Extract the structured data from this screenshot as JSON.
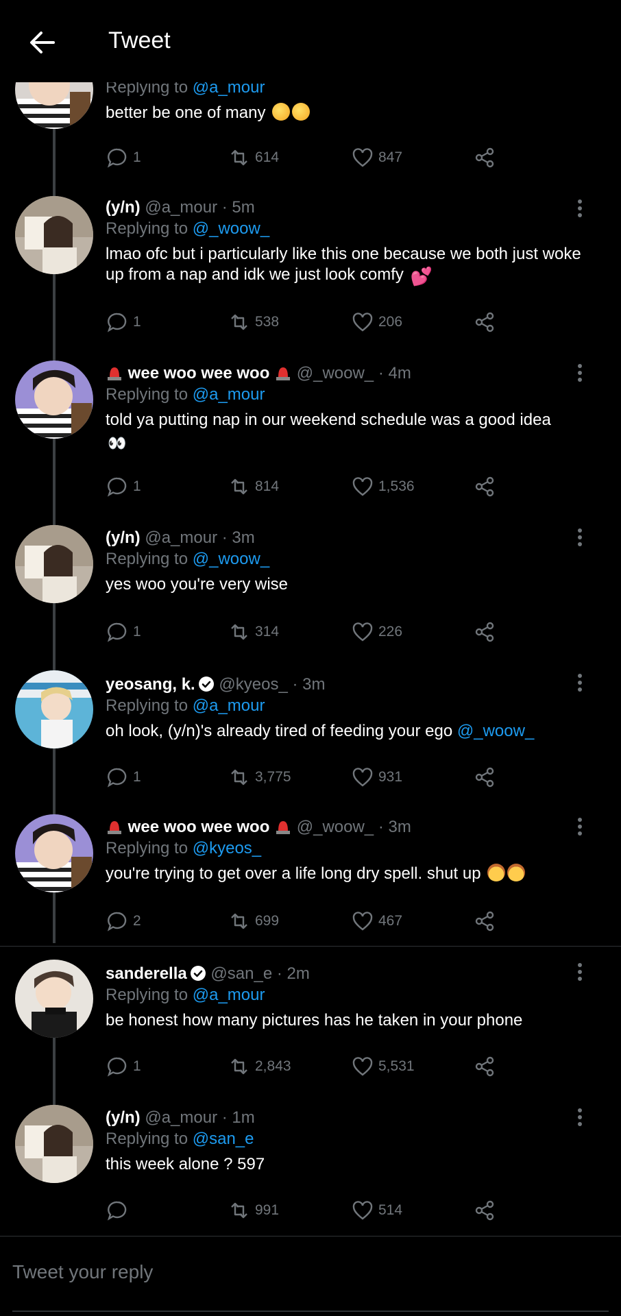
{
  "header": {
    "title": "Tweet"
  },
  "tweets": [
    {
      "name": "",
      "handle": "",
      "time": "",
      "reply_label": "Replying to",
      "reply_to": "@a_mour",
      "text": "better be one of many",
      "replies": "1",
      "retweets": "614",
      "likes": "847",
      "avatar": "boy-striped"
    },
    {
      "name": "(y/n)",
      "handle": "@a_mour",
      "time": "5m",
      "reply_label": "Replying to",
      "reply_to": "@_woow_",
      "text": "lmao ofc but i particularly like this one because we both just woke up from a nap and idk we just look comfy",
      "replies": "1",
      "retweets": "538",
      "likes": "206",
      "avatar": "girl-book"
    },
    {
      "name": "wee woo wee woo",
      "handle": "@_woow_",
      "time": "4m",
      "reply_label": "Replying to",
      "reply_to": "@a_mour",
      "text": "told ya putting nap in our weekend schedule was a good idea",
      "replies": "1",
      "retweets": "814",
      "likes": "1,536",
      "avatar": "boy-striped"
    },
    {
      "name": "(y/n)",
      "handle": "@a_mour",
      "time": "3m",
      "reply_label": "Replying to",
      "reply_to": "@_woow_",
      "text": "yes woo you're very wise",
      "replies": "1",
      "retweets": "314",
      "likes": "226",
      "avatar": "girl-book"
    },
    {
      "name": "yeosang, k.",
      "handle": "@kyeos_",
      "time": "3m",
      "reply_label": "Replying to",
      "reply_to": "@a_mour",
      "text": "oh look, (y/n)'s already tired of feeding your ego",
      "text_mention": "@_woow_",
      "replies": "1",
      "retweets": "3,775",
      "likes": "931",
      "avatar": "boy-pool"
    },
    {
      "name": "wee woo wee woo",
      "handle": "@_woow_",
      "time": "3m",
      "reply_label": "Replying to",
      "reply_to": "@kyeos_",
      "text": "you're trying to get over a life long dry spell. shut up",
      "replies": "2",
      "retweets": "699",
      "likes": "467",
      "avatar": "boy-striped"
    },
    {
      "name": "sanderella",
      "handle": "@san_e",
      "time": "2m",
      "reply_label": "Replying to",
      "reply_to": "@a_mour",
      "text": "be honest how many pictures has he taken in your phone",
      "replies": "1",
      "retweets": "2,843",
      "likes": "5,531",
      "avatar": "boy-black"
    },
    {
      "name": "(y/n)",
      "handle": "@a_mour",
      "time": "1m",
      "reply_label": "Replying to",
      "reply_to": "@san_e",
      "text": "this week alone ? 597",
      "replies": "",
      "retweets": "991",
      "likes": "514",
      "avatar": "girl-book"
    }
  ],
  "reply_box": {
    "placeholder": "Tweet your reply"
  },
  "colors": {
    "background": "#000000",
    "link": "#1d9bf0",
    "muted": "#71767b",
    "text": "#ffffff"
  }
}
